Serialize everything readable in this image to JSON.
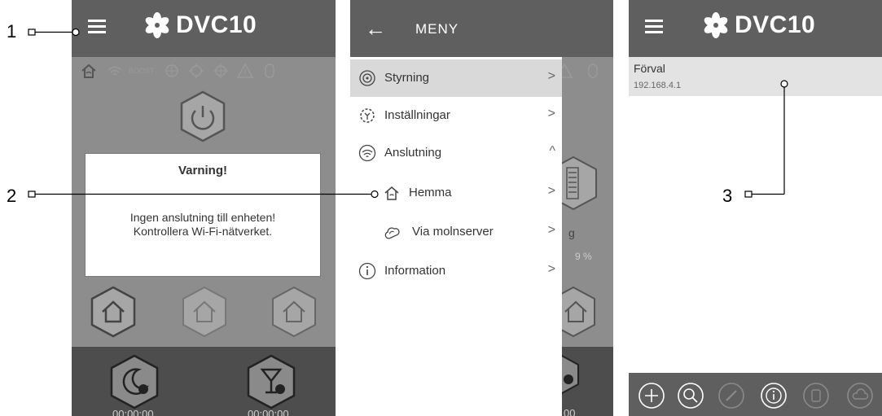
{
  "screen1": {
    "app_title": "DVC10",
    "status_icons": [
      "home-icon",
      "wifi-icon",
      "boost-icon",
      "fan-icon",
      "heater-icon",
      "cooler-icon",
      "warning-icon",
      "filter-icon"
    ],
    "boost_label": "BOOST",
    "warning_dialog": {
      "title": "Varning!",
      "message_line1": "Ingen anslutning till enheten!",
      "message_line2": "Kontrollera Wi-Fi-nätverket."
    },
    "timers": [
      "00:00:00",
      "00:00:00"
    ]
  },
  "screen2": {
    "drawer_title": "MENY",
    "menu": [
      {
        "label": "Styrning",
        "icon": "control-icon",
        "chevron": ">"
      },
      {
        "label": "Inställningar",
        "icon": "settings-icon",
        "chevron": ">"
      },
      {
        "label": "Anslutning",
        "icon": "wifi-icon",
        "chevron": "^"
      },
      {
        "label": "Hemma",
        "icon": "home-icon",
        "chevron": ">"
      },
      {
        "label": "Via molnserver",
        "icon": "cloud-icon",
        "chevron": ">"
      },
      {
        "label": "Information",
        "icon": "info-icon",
        "chevron": ">"
      }
    ],
    "bg_fragments": {
      "letter": "g",
      "percent": "9 %",
      "timer_tail": "00"
    }
  },
  "screen3": {
    "app_title": "DVC10",
    "preset": {
      "name": "Förval",
      "ip": "192.168.4.1"
    },
    "toolbar_icons": [
      "add-icon",
      "search-icon",
      "edit-icon",
      "info-icon",
      "delete-icon",
      "cloud-icon"
    ]
  },
  "callouts": [
    "1",
    "2",
    "3"
  ],
  "colors": {
    "topbar": "#5f5f5f",
    "overlay": "#8d8d8d",
    "bottom_bar": "#4d4d4d",
    "drawer_active": "#d9d9d9"
  }
}
